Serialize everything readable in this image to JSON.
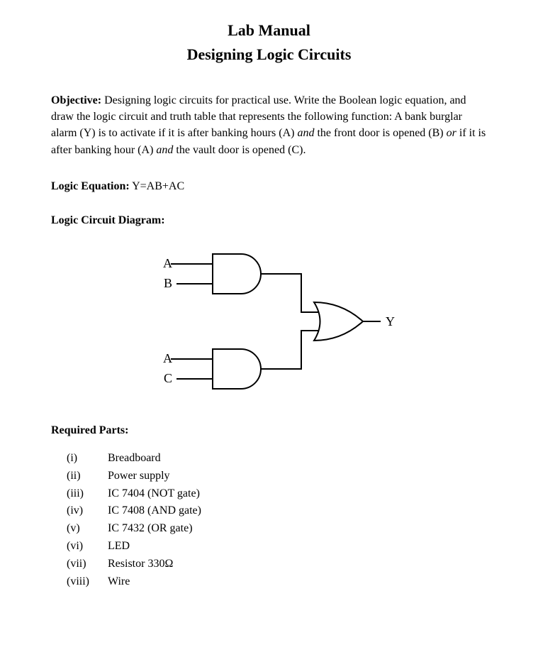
{
  "title1": "Lab Manual",
  "title2": "Designing Logic Circuits",
  "objective_label": "Objective:",
  "objective_text_1": " Designing logic circuits for practical use. Write the Boolean logic equation, and draw the logic circuit and truth table that represents the following function: A bank burglar alarm (Y) is to activate if it is after banking hours (A) ",
  "word_and": "and",
  "objective_text_2": " the front door is opened (B) ",
  "word_or": "or",
  "objective_text_3": " if it is after banking hour (A) ",
  "objective_text_4": " the vault door is opened (C).",
  "logic_eq_label": "Logic Equation:",
  "logic_eq_value": " Y=AB+AC",
  "diagram_label": "Logic Circuit Diagram:",
  "circuit": {
    "in_top_a": "A",
    "in_top_b": "B",
    "in_bot_a": "A",
    "in_bot_c": "C",
    "output": "Y"
  },
  "parts_label": "Required Parts:",
  "parts": [
    {
      "num": "(i)",
      "name": "Breadboard"
    },
    {
      "num": "(ii)",
      "name": "Power supply"
    },
    {
      "num": "(iii)",
      "name": "IC 7404 (NOT gate)"
    },
    {
      "num": "(iv)",
      "name": "IC 7408 (AND gate)"
    },
    {
      "num": "(v)",
      "name": "IC 7432 (OR gate)"
    },
    {
      "num": "(vi)",
      "name": "LED"
    },
    {
      "num": "(vii)",
      "name": "Resistor 330Ω"
    },
    {
      "num": "(viii)",
      "name": "Wire"
    }
  ]
}
